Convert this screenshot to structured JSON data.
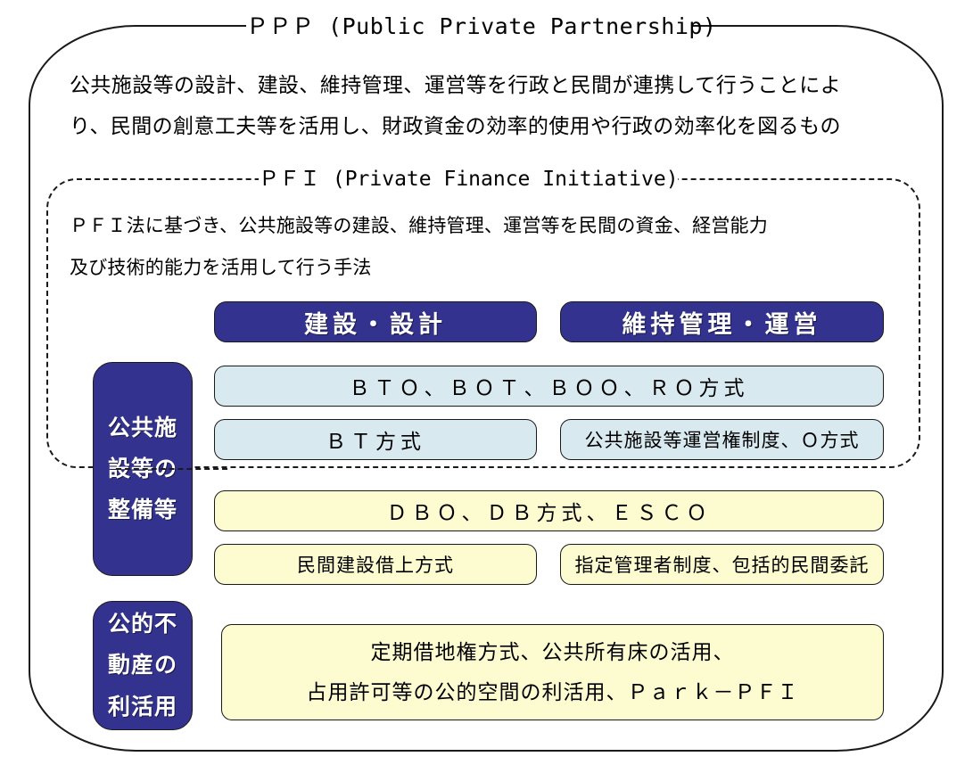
{
  "outer": {
    "title": "ＰＰＰ (Public Private Partnership)",
    "description_lines": [
      "公共施設等の設計、建設、維持管理、運営等を行政と民間が連携して行うことによ",
      "り、民間の創意工夫等を活用し、財政資金の効率的使用や行政の効率化を図るもの"
    ]
  },
  "pfi": {
    "title": "ＰＦＩ (Private Finance Initiative)",
    "description_lines": [
      "ＰＦＩ法に基づき、公共施設等の建設、維持管理、運営等を民間の資金、経営能力",
      "及び技術的能力を活用して行う手法"
    ]
  },
  "column_headers": {
    "left": "建設・設計",
    "right": "維持管理・運営"
  },
  "categories": {
    "facilities": {
      "lines": [
        "公共施",
        "設等の",
        "整備等"
      ]
    },
    "public_real_estate": {
      "lines": [
        "公的不",
        "動産の",
        "利活用"
      ]
    }
  },
  "rows": {
    "pfi_full": "ＢＴＯ、ＢＯＴ、ＢＯＯ、ＲＯ方式",
    "pfi_left": "ＢＴ方式",
    "pfi_right": "公共施設等運営権制度、Ｏ方式",
    "non_pfi_full": "ＤＢＯ、ＤＢ方式、ＥＳＣＯ",
    "non_pfi_left": "民間建設借上方式",
    "non_pfi_right": "指定管理者制度、包括的民間委託",
    "pre_line1": "定期借地権方式、公共所有床の活用、",
    "pre_line2": "占用許可等の公的空間の利活用、Ｐａｒｋ－ＰＦＩ"
  },
  "colors": {
    "navy": "#33338f",
    "light_blue": "#d9e9f0",
    "light_yellow": "#fdfbd0",
    "outline": "#1a1a1a",
    "page_background": "#ffffff"
  }
}
